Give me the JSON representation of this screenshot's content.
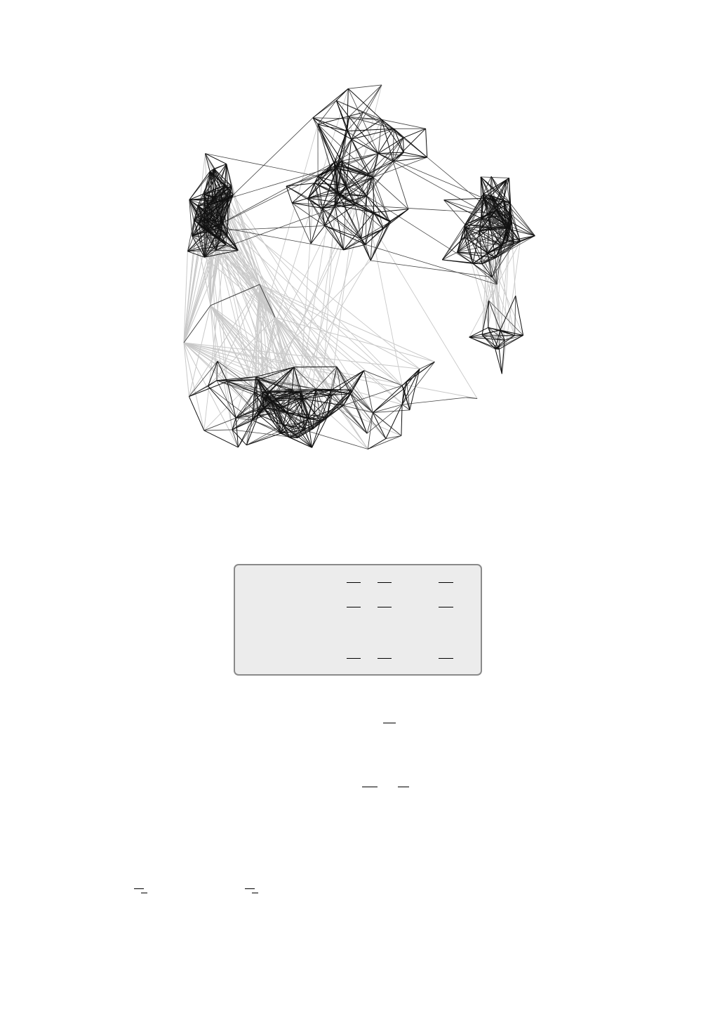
{
  "page": {
    "background": "#ffffff"
  },
  "figure": {
    "palette": {
      "dark": "#111111",
      "mid": "#444444",
      "light": "#c8c8c8"
    },
    "clusters": [
      {
        "label": "",
        "edge_shade": "dark"
      },
      {
        "label": "",
        "edge_shade": "dark"
      },
      {
        "label": "",
        "edge_shade": "dark"
      },
      {
        "label": "",
        "edge_shade": "dark"
      }
    ]
  },
  "box": {
    "background": "#ececec",
    "border": "#8a8a8a",
    "rows": [
      {
        "marks": [
          "overline",
          "overline",
          "overline"
        ]
      },
      {
        "marks": [
          "overline",
          "overline",
          "overline"
        ]
      },
      {
        "marks": [
          "overline",
          "overline",
          "overline"
        ]
      }
    ]
  },
  "equations": [
    {
      "marks": [
        "overline"
      ]
    },
    {
      "marks": [
        "overline",
        "overline"
      ]
    },
    {
      "marks": [
        "overline",
        "overline"
      ]
    }
  ]
}
